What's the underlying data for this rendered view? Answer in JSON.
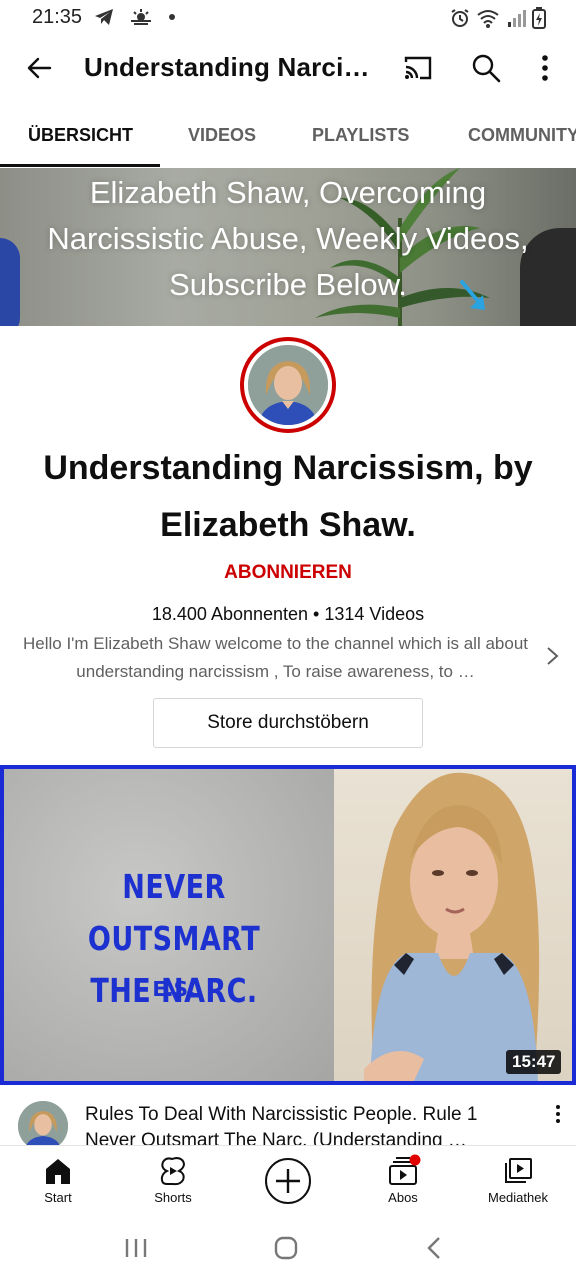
{
  "status_bar": {
    "time": "21:35"
  },
  "app_bar": {
    "title": "Understanding Narcissism, by Elizabeth Shaw."
  },
  "tabs": [
    {
      "label": "ÜBERSICHT",
      "active": true
    },
    {
      "label": "VIDEOS",
      "active": false
    },
    {
      "label": "PLAYLISTS",
      "active": false
    },
    {
      "label": "COMMUNITY",
      "active": false
    }
  ],
  "banner": {
    "line1": "Elizabeth Shaw, Overcoming",
    "line2": "Narcissistic Abuse, Weekly Videos,",
    "line3": "Subscribe Below."
  },
  "channel": {
    "name": "Understanding Narcissism, by Elizabeth Shaw.",
    "subscribe_label": "ABONNIEREN",
    "stats": "18.400 Abonnenten • 1314 Videos",
    "description": "Hello I'm Elizabeth Shaw welcome to the channel which is all about understanding narcissism , To raise awareness, to …",
    "store_button": "Store durchstöbern"
  },
  "video": {
    "thumb_headline_1": "NEVER OUTSMART",
    "thumb_headline_2": "THE NARC.",
    "thumb_initials": "E.S.",
    "duration": "15:47",
    "title": "Rules To Deal With Narcissistic People. Rule 1 Never Outsmart The Narc. (Understanding …"
  },
  "bottom_nav": [
    {
      "label": "Start",
      "icon": "home-icon",
      "active": true
    },
    {
      "label": "Shorts",
      "icon": "shorts-icon",
      "active": false
    },
    {
      "label": "",
      "icon": "create-icon",
      "active": false
    },
    {
      "label": "Abos",
      "icon": "subscriptions-icon",
      "active": false,
      "badge": true
    },
    {
      "label": "Mediathek",
      "icon": "library-icon",
      "active": false
    }
  ],
  "colors": {
    "accent": "#cc0000",
    "thumb_border": "#1a2bd6",
    "thumb_text": "#1c31d0"
  }
}
